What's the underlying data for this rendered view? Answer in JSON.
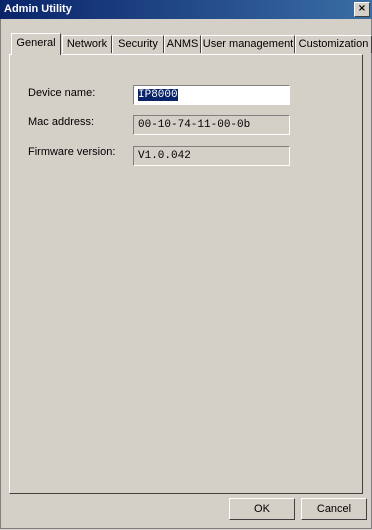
{
  "window": {
    "title": "Admin Utility",
    "close_glyph": "×"
  },
  "tabs": [
    {
      "label": "General"
    },
    {
      "label": "Network"
    },
    {
      "label": "Security"
    },
    {
      "label": "ANMS"
    },
    {
      "label": "User management"
    },
    {
      "label": "Customization"
    }
  ],
  "active_tab": "General",
  "general": {
    "device_name_label": "Device name:",
    "device_name_value": "IP8000",
    "mac_label": "Mac address:",
    "mac_value": "00-10-74-11-00-0b",
    "firmware_label": "Firmware version:",
    "firmware_value": "V1.0.042"
  },
  "buttons": {
    "ok": "OK",
    "cancel": "Cancel"
  }
}
